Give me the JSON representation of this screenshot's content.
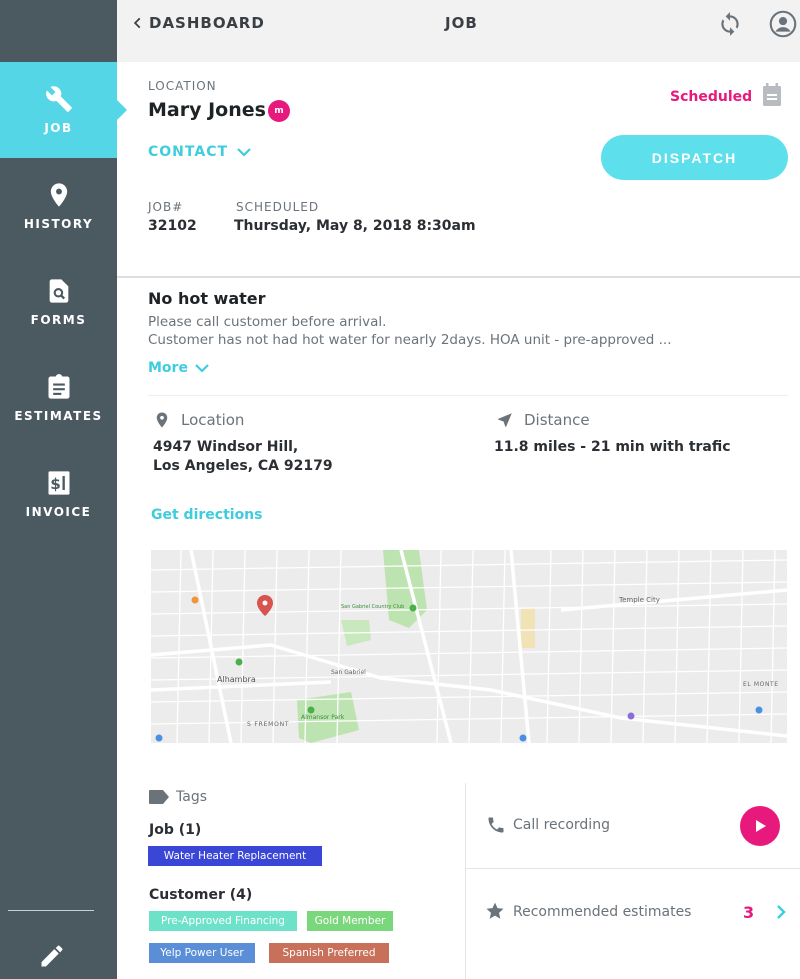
{
  "sidebar": {
    "items": [
      {
        "label": "JOB",
        "icon": "wrench-icon",
        "active": true
      },
      {
        "label": "HISTORY",
        "icon": "map-pin-icon",
        "active": false
      },
      {
        "label": "FORMS",
        "icon": "form-search-icon",
        "active": false
      },
      {
        "label": "ESTIMATES",
        "icon": "clipboard-icon",
        "active": false
      },
      {
        "label": "INVOICE",
        "icon": "dollar-invoice-icon",
        "active": false
      }
    ],
    "footer_icon": "pencil-icon"
  },
  "topbar": {
    "back_label": "DASHBOARD",
    "title": "JOB",
    "sync_icon": "sync-icon",
    "user_icon": "user-circle-icon"
  },
  "job": {
    "location_label": "LOCATION",
    "customer_name": "Mary Jones",
    "avatar_initial": "m",
    "status": "Scheduled",
    "contact_label": "CONTACT",
    "dispatch_label": "DISPATCH",
    "job_number_label": "JOB#",
    "job_number": "32102",
    "scheduled_label": "SCHEDULED",
    "scheduled_value": "Thursday, May 8, 2018 8:30am"
  },
  "description": {
    "title": "No hot water",
    "line1": "Please call customer before arrival.",
    "line2": "Customer has not had hot water for nearly 2days. HOA unit - pre-approved ...",
    "more_label": "More"
  },
  "location": {
    "label": "Location",
    "address_line1": "4947 Windsor Hill,",
    "address_line2": "Los Angeles, CA 92179",
    "distance_label": "Distance",
    "distance_value": "11.8 miles - 21 min with trafic",
    "directions_label": "Get directions"
  },
  "map": {
    "labels": {
      "town": "Alhambra",
      "street": "S FREMONT",
      "park": "Almansor Park",
      "area": "Temple City",
      "club": "San Gabriel Country Club",
      "mission": "San Gabriel",
      "el_monte": "EL MONTE"
    }
  },
  "tags": {
    "header": "Tags",
    "job_group_label": "Job (1)",
    "job_tags": [
      {
        "label": "Water Heater Replacement",
        "color": "#3a46d6"
      }
    ],
    "customer_group_label": "Customer (4)",
    "customer_tags": [
      {
        "label": "Pre-Approved Financing",
        "color": "#6ee2c8"
      },
      {
        "label": "Gold Member",
        "color": "#7bd77b"
      },
      {
        "label": "Yelp Power User",
        "color": "#5a8fd8"
      },
      {
        "label": "Spanish Preferred",
        "color": "#c9705a"
      }
    ]
  },
  "actions": {
    "call_recording_label": "Call recording",
    "recommended_label": "Recommended estimates",
    "recommended_count": "3"
  },
  "colors": {
    "accent": "#55d6e6",
    "brand_pink": "#e8197c",
    "sidebar": "#4b5a61"
  }
}
